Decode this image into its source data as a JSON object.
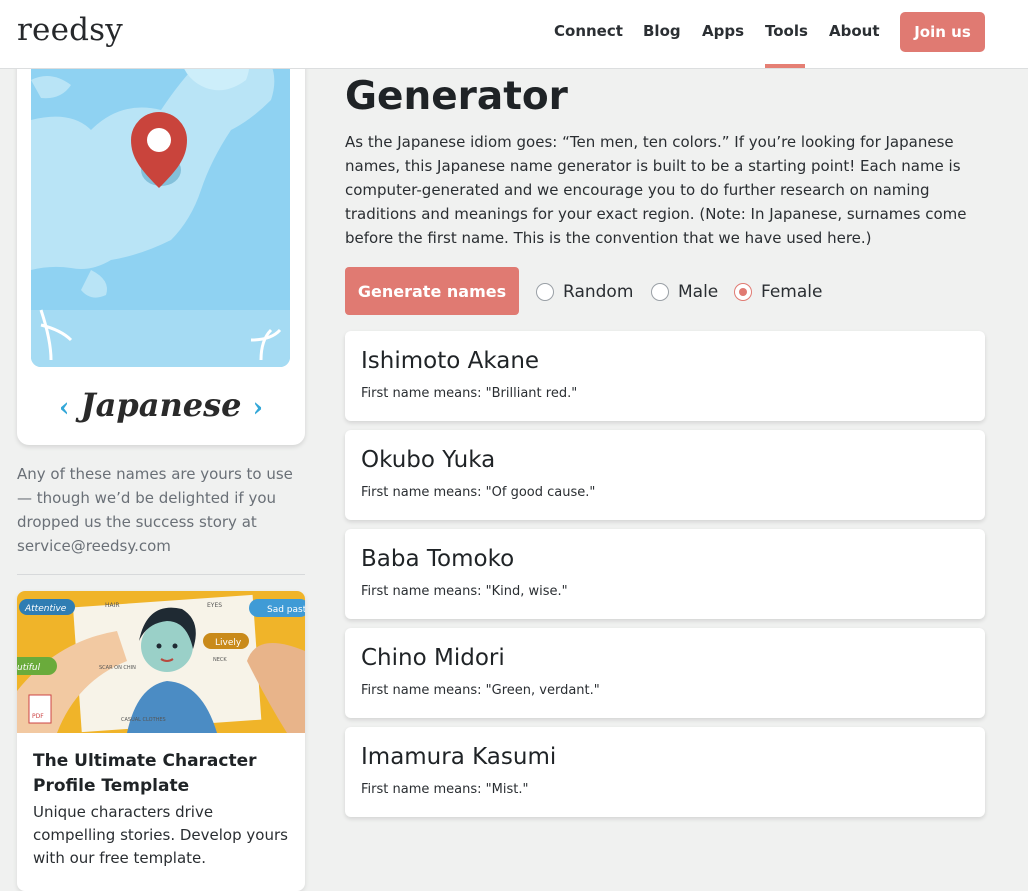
{
  "header": {
    "logo": "reedsy",
    "nav": [
      "Connect",
      "Blog",
      "Apps",
      "Tools",
      "About"
    ],
    "active_nav": "Tools",
    "join_label": "Join us",
    "accent_color": "#e07a72"
  },
  "sidebar": {
    "language": "Japanese",
    "prev_icon": "chevron-left-icon",
    "next_icon": "chevron-right-icon",
    "note": "Any of these names are yours to use — though we’d be delighted if you dropped us the success story at service@reedsy.com",
    "promo": {
      "title": "The Ultimate Character Profile Template",
      "description": "Unique characters drive compelling stories. Develop yours with our free template.",
      "image_labels": [
        "Attentive",
        "HAIR",
        "EYES",
        "Sad past",
        "Lively",
        "SCAR ON CHIN",
        "NECK",
        "CASUAL CLOTHES",
        "utiful",
        "PDF"
      ]
    }
  },
  "main": {
    "title": "Generator",
    "intro": "As the Japanese idiom goes: “Ten men, ten colors.” If you’re looking for Japanese names, this Japanese name generator is built to be a starting point! Each name is computer-generated and we encourage you to do further research on naming traditions and meanings for your exact region. (Note: In Japanese, surnames come before the first name. This is the convention that we have used here.)",
    "generate_label": "Generate names",
    "options": [
      {
        "label": "Random",
        "checked": false
      },
      {
        "label": "Male",
        "checked": false
      },
      {
        "label": "Female",
        "checked": true
      }
    ],
    "names": [
      {
        "name": "Ishimoto Akane",
        "meaning": "First name means: \"Brilliant red.\""
      },
      {
        "name": "Okubo Yuka",
        "meaning": "First name means: \"Of good cause.\""
      },
      {
        "name": "Baba Tomoko",
        "meaning": "First name means: \"Kind, wise.\""
      },
      {
        "name": "Chino Midori",
        "meaning": "First name means: \"Green, verdant.\""
      },
      {
        "name": "Imamura Kasumi",
        "meaning": "First name means: \"Mist.\""
      }
    ]
  }
}
